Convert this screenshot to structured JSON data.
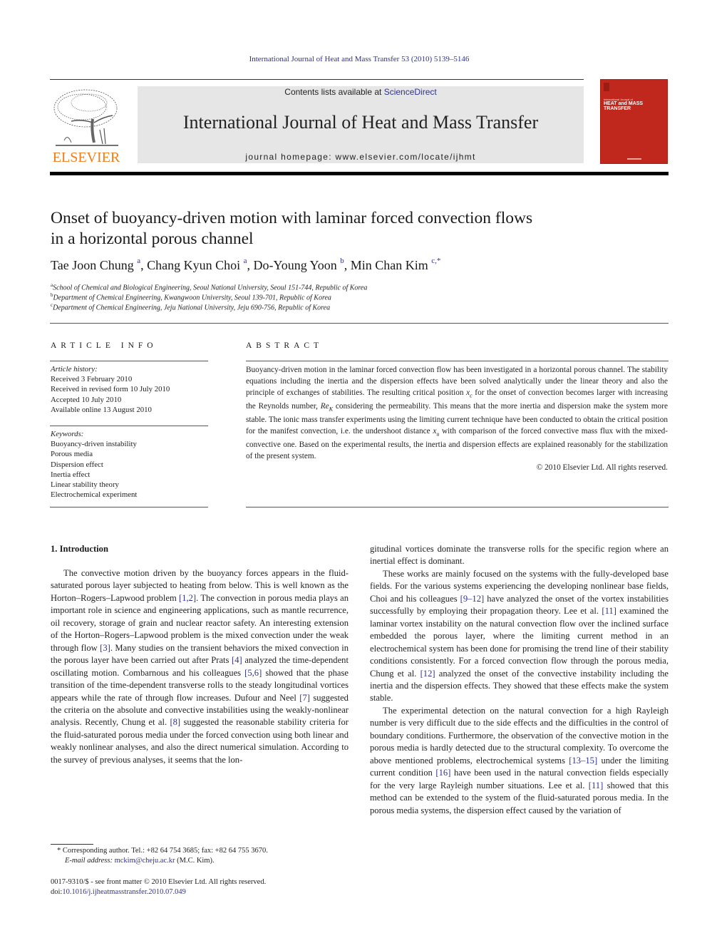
{
  "header": {
    "citation": "International Journal of Heat and Mass Transfer 53 (2010) 5139–5146",
    "contents_prefix": "Contents lists available at ",
    "contents_link": "ScienceDirect",
    "journal_title": "International Journal of Heat and Mass Transfer",
    "homepage_prefix": "journal homepage: ",
    "homepage_url": "www.elsevier.com/locate/ijhmt",
    "publisher_logo_text": "ELSEVIER",
    "cover": {
      "small_text": "International Journal of",
      "title_line1": "HEAT and MASS",
      "title_line2": "TRANSFER"
    }
  },
  "colors": {
    "link": "#2e3192",
    "elsevier_orange": "#f07d1a",
    "cover_red": "#c0281e",
    "masthead_gray": "#e6e6e6"
  },
  "article": {
    "title_line1": "Onset of buoyancy-driven motion with laminar forced convection flows",
    "title_line2": "in a horizontal porous channel",
    "authors": [
      {
        "name": "Tae Joon Chung",
        "sup": "a",
        "sep": ", "
      },
      {
        "name": "Chang Kyun Choi",
        "sup": "a",
        "sep": ", "
      },
      {
        "name": "Do-Young Yoon",
        "sup": "b",
        "sep": ", "
      },
      {
        "name": "Min Chan Kim",
        "sup": "c,*",
        "sep": ""
      }
    ],
    "affiliations": [
      {
        "key": "a",
        "text": "School of Chemical and Biological Engineering, Seoul National University, Seoul 151-744, Republic of Korea"
      },
      {
        "key": "b",
        "text": "Department of Chemical Engineering, Kwangwoon University, Seoul 139-701, Republic of Korea"
      },
      {
        "key": "c",
        "text": "Department of Chemical Engineering, Jeju National University, Jeju 690-756, Republic of Korea"
      }
    ]
  },
  "article_info": {
    "heading": "ARTICLE INFO",
    "history_label": "Article history:",
    "history": [
      "Received 3 February 2010",
      "Received in revised form 10 July 2010",
      "Accepted 10 July 2010",
      "Available online 13 August 2010"
    ],
    "keywords_label": "Keywords:",
    "keywords": [
      "Buoyancy-driven instability",
      "Porous media",
      "Dispersion effect",
      "Inertia effect",
      "Linear stability theory",
      "Electrochemical experiment"
    ]
  },
  "abstract": {
    "heading": "ABSTRACT",
    "part1": "Buoyancy-driven motion in the laminar forced convection flow has been investigated in a horizontal porous channel. The stability equations including the inertia and the dispersion effects have been solved analytically under the linear theory and also the principle of exchanges of stabilities. The resulting critical position ",
    "xc_var": "x",
    "xc_sub": "c",
    "part2": " for the onset of convection becomes larger with increasing the Reynolds number, ",
    "re_var": "Re",
    "re_sub": "K",
    "part3": " considering the permeability. This means that the more inertia and dispersion make the system more stable. The ionic mass transfer experiments using the limiting current technique have been conducted to obtain the critical position for the manifest convection, i.e. the undershoot distance ",
    "xu_var": "x",
    "xu_sub": "u",
    "part4": " with comparison of the forced convective mass flux with the mixed-convective one. Based on the experimental results, the inertia and dispersion effects are explained reasonably for the stabilization of the present system.",
    "copyright": "© 2010 Elsevier Ltd. All rights reserved."
  },
  "introduction": {
    "heading": "1. Introduction",
    "left_col": [
      {
        "t": "The convective motion driven by the buoyancy forces appears in the fluid-saturated porous layer subjected to heating from below. This is well known as the Horton–Rogers–Lapwood problem "
      },
      {
        "ref": "[1,2]"
      },
      {
        "t": ". The convection in porous media plays an important role in science and engineering applications, such as mantle recurrence, oil recovery, storage of grain and nuclear reactor safety. An interesting extension of the Horton–Rogers–Lapwood problem is the mixed convection under the weak through flow "
      },
      {
        "ref": "[3]"
      },
      {
        "t": ". Many studies on the transient behaviors the mixed convection in the porous layer have been carried out after Prats "
      },
      {
        "ref": "[4]"
      },
      {
        "t": " analyzed the time-dependent oscillating motion. Combarnous and his colleagues "
      },
      {
        "ref": "[5,6]"
      },
      {
        "t": " showed that the phase transition of the time-dependent transverse rolls to the steady longitudinal vortices appears while the rate of through flow increases. Dufour and Neel "
      },
      {
        "ref": "[7]"
      },
      {
        "t": " suggested the criteria on the absolute and convective instabilities using the weakly-nonlinear analysis. Recently, Chung et al. "
      },
      {
        "ref": "[8]"
      },
      {
        "t": " suggested the reasonable stability criteria for the fluid-saturated porous media under the forced convection using both linear and weakly nonlinear analyses, and also the direct numerical simulation. According to the survey of previous analyses, it seems that the lon-"
      }
    ],
    "right_col_cont": "gitudinal vortices dominate the transverse rolls for the specific region where an inertial effect is dominant.",
    "right_p2": [
      {
        "t": "These works are mainly focused on the systems with the fully-developed base fields. For the various systems experiencing the developing nonlinear base fields, Choi and his colleagues "
      },
      {
        "ref": "[9–12]"
      },
      {
        "t": " have analyzed the onset of the vortex instabilities successfully by employing their propagation theory. Lee et al. "
      },
      {
        "ref": "[11]"
      },
      {
        "t": " examined the laminar vortex instability on the natural convection flow over the inclined surface embedded the porous layer, where the limiting current method in an electrochemical system has been done for promising the trend line of their stability conditions consistently. For a forced convection flow through the porous media, Chung et al. "
      },
      {
        "ref": "[12]"
      },
      {
        "t": " analyzed the onset of the convective instability including the inertia and the dispersion effects. They showed that these effects make the system stable."
      }
    ],
    "right_p3": [
      {
        "t": "The experimental detection on the natural convection for a high Rayleigh number is very difficult due to the side effects and the difficulties in the control of boundary conditions. Furthermore, the observation of the convective motion in the porous media is hardly detected due to the structural complexity. To overcome the above mentioned problems, electrochemical systems "
      },
      {
        "ref": "[13–15]"
      },
      {
        "t": " under the limiting current condition "
      },
      {
        "ref": "[16]"
      },
      {
        "t": " have been used in the natural convection fields especially for the very large Rayleigh number situations. Lee et al. "
      },
      {
        "ref": "[11]"
      },
      {
        "t": " showed that this method can be extended to the system of the fluid-saturated porous media. In the porous media systems, the dispersion effect caused by the variation of"
      }
    ]
  },
  "footnotes": {
    "corresponding": "* Corresponding author. Tel.: +82 64 754 3685; fax: +82 64 755 3670.",
    "email_label": "E-mail address: ",
    "email": "mckim@cheju.ac.kr",
    "email_suffix": " (M.C. Kim).",
    "issn_line": "0017-9310/$ - see front matter © 2010 Elsevier Ltd. All rights reserved.",
    "doi_prefix": "doi:",
    "doi": "10.1016/j.ijheatmasstransfer.2010.07.049"
  }
}
